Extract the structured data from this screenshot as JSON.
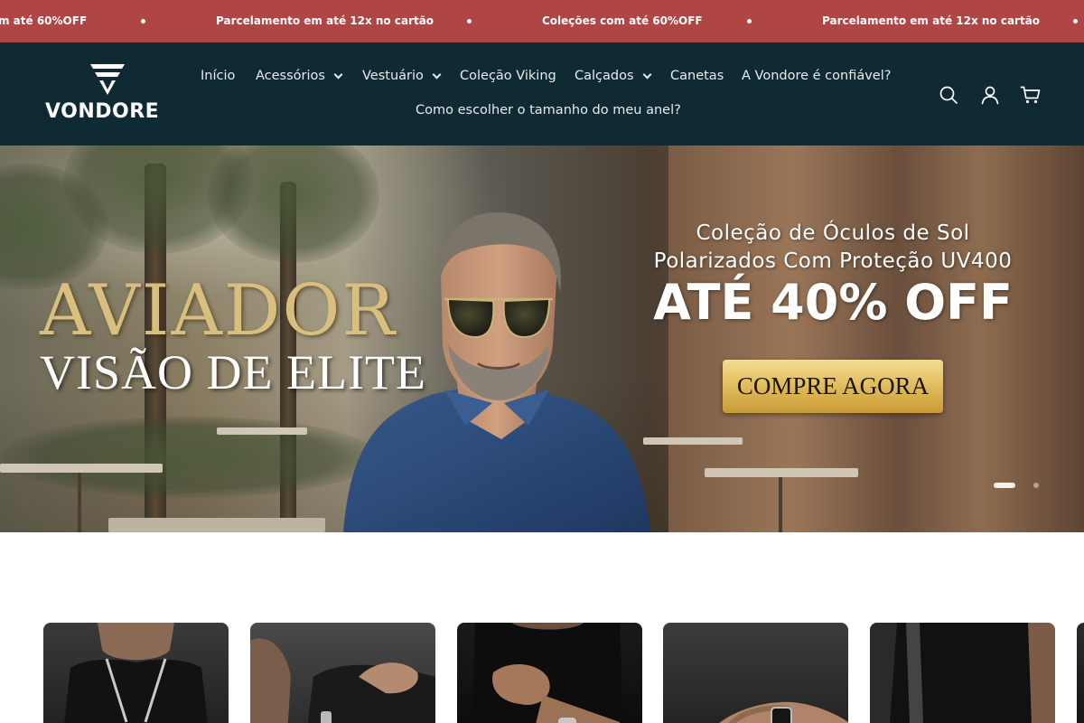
{
  "announcement": {
    "items": [
      "m até 60%OFF",
      "Parcelamento em até 12x no cartão",
      "Coleções com até 60%OFF",
      "Parcelamento em até 12x no cartão"
    ]
  },
  "brand": {
    "name": "VONDORE"
  },
  "nav": {
    "items": [
      {
        "label": "Início",
        "has_dropdown": false
      },
      {
        "label": "Acessórios",
        "has_dropdown": true
      },
      {
        "label": "Vestuário",
        "has_dropdown": true
      },
      {
        "label": "Coleção Viking",
        "has_dropdown": false
      },
      {
        "label": "Calçados",
        "has_dropdown": true
      },
      {
        "label": "Canetas",
        "has_dropdown": false
      },
      {
        "label": "A Vondore é confiável?",
        "has_dropdown": false
      },
      {
        "label": "Como escolher o tamanho do meu anel?",
        "has_dropdown": false
      }
    ]
  },
  "header_icons": [
    "search-icon",
    "account-icon",
    "cart-icon"
  ],
  "hero": {
    "headline": "AVIADOR",
    "subheadline": "VISÃO DE ELITE",
    "promo_line1": "Coleção de Óculos de Sol",
    "promo_line2": "Polarizados Com Proteção UV400",
    "discount": "ATÉ 40% OFF",
    "cta": "COMPRE AGORA",
    "slides_total": 2,
    "active_slide": 1
  },
  "colors": {
    "announcement_bg": "#b04545",
    "header_bg": "#0f2a33",
    "gold": "#d9bf7f",
    "cta_gold": "#e2bf61"
  },
  "categories": {
    "cards": [
      {
        "image": "man-with-chain-necklace"
      },
      {
        "image": "hand-with-bracelet"
      },
      {
        "image": "wrist-with-watch"
      },
      {
        "image": "hand-with-ring"
      },
      {
        "image": "man-with-bag-strap"
      }
    ]
  }
}
